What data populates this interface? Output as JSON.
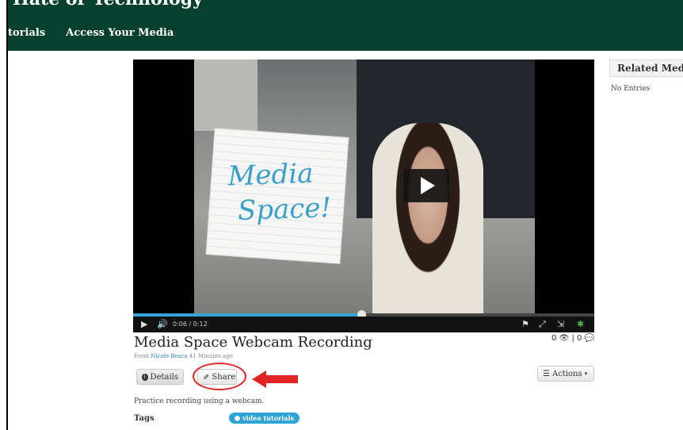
{
  "header": {
    "site_title": "Hate or Technology",
    "nav": [
      {
        "label": "torials"
      },
      {
        "label": "Access Your Media"
      }
    ]
  },
  "player": {
    "current_time": "0:06",
    "duration": "/ 0:12",
    "progress": 0.5,
    "paper_text": "Media\n Space!"
  },
  "media": {
    "title": "Media Space Webcam Recording",
    "from_prefix": "From",
    "author": "Nicole Bosca",
    "age": "41 Minutes ago",
    "views": "0",
    "comments": "0",
    "description": "Practice recording using a webcam.",
    "tags_label": "Tags",
    "tag": "video tutorials"
  },
  "buttons": {
    "details": "Details",
    "share": "Share",
    "actions": "Actions"
  },
  "sidebar": {
    "related_title": "Related Media",
    "empty_text": "No Entries"
  },
  "colors": {
    "header_bg": "#07402f",
    "progress": "#35a4d6",
    "highlight": "#e02424",
    "tag": "#2ea3d5"
  }
}
